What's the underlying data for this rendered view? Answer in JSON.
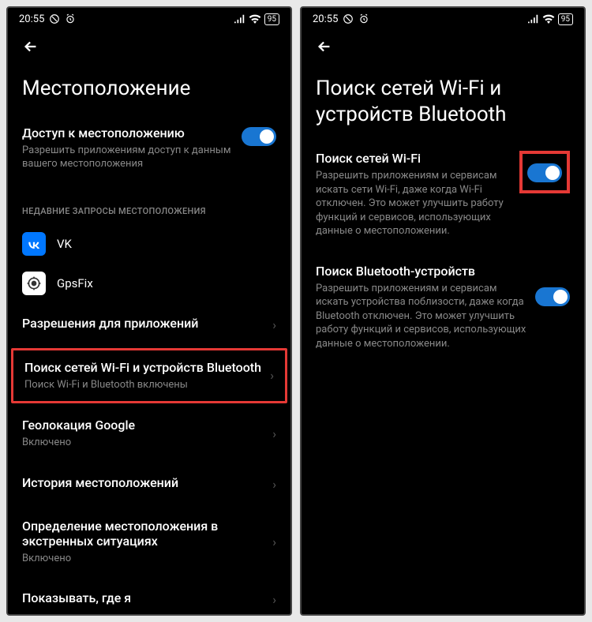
{
  "status_bar": {
    "time": "20:55",
    "battery": "95"
  },
  "left_screen": {
    "title": "Местоположение",
    "location_access": {
      "title": "Доступ к местоположению",
      "sub": "Разрешить приложениям доступ к данным вашего местоположения"
    },
    "recent_label": "НЕДАВНИЕ ЗАПРОСЫ МЕСТОПОЛОЖЕНИЯ",
    "apps": [
      {
        "name": "VK"
      },
      {
        "name": "GpsFix"
      }
    ],
    "rows": [
      {
        "title": "Разрешения для приложений",
        "sub": ""
      },
      {
        "title": "Поиск сетей Wi-Fi и устройств Bluetooth",
        "sub": "Поиск Wi-Fi и Bluetooth включены"
      },
      {
        "title": "Геолокация Google",
        "sub": "Включено"
      },
      {
        "title": "История местоположений",
        "sub": ""
      },
      {
        "title": "Определение местоположения в экстренных ситуациях",
        "sub": "Включено"
      },
      {
        "title": "Показывать, где я",
        "sub": ""
      }
    ]
  },
  "right_screen": {
    "title": "Поиск сетей Wi-Fi и устройств Bluetooth",
    "wifi": {
      "title": "Поиск сетей Wi-Fi",
      "sub": "Разрешить приложениям и сервисам искать сети Wi-Fi, даже когда Wi-Fi отключен. Это может улучшить работу функций и сервисов, использующих данные о местоположении."
    },
    "bt": {
      "title": "Поиск Bluetooth-устройств",
      "sub": "Разрешить приложениям и сервисам искать устройства поблизости, даже когда Bluetooth отключен. Это может улучшить работу функций и сервисов, использующих данные о местоположении."
    }
  }
}
